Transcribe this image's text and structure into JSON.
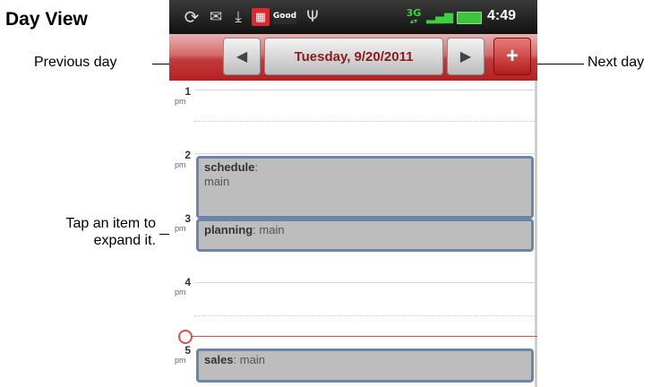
{
  "doc_title": "Day View",
  "callouts": {
    "previous_day": "Previous day",
    "next_day": "Next day",
    "tap_item_line1": "Tap an item to",
    "tap_item_line2": "expand it."
  },
  "statusbar": {
    "network": "3G",
    "time": "4:49",
    "icons": [
      "sync-icon",
      "mail-icon",
      "download-icon",
      "calendar-icon",
      "good-icon",
      "usb-icon",
      "network-3g-icon",
      "signal-icon",
      "battery-icon"
    ],
    "good_label": "Good"
  },
  "header": {
    "date": "Tuesday, 9/20/2011",
    "prev_glyph": "◀",
    "next_glyph": "▶",
    "add_glyph": "+"
  },
  "hours": [
    {
      "num": "1",
      "suffix": "pm"
    },
    {
      "num": "2",
      "suffix": "pm"
    },
    {
      "num": "3",
      "suffix": "pm"
    },
    {
      "num": "4",
      "suffix": "pm"
    },
    {
      "num": "5",
      "suffix": "pm"
    }
  ],
  "events": [
    {
      "title": "schedule",
      "sep": ":",
      "location": "main"
    },
    {
      "title": "planning",
      "sep": ": ",
      "location": "main"
    },
    {
      "title": "sales",
      "sep": ": ",
      "location": "main"
    }
  ],
  "colors": {
    "header_red": "#b42222",
    "event_fill": "#bdbdbd",
    "event_border": "#6b86ad",
    "now_line": "#e34b4b"
  }
}
